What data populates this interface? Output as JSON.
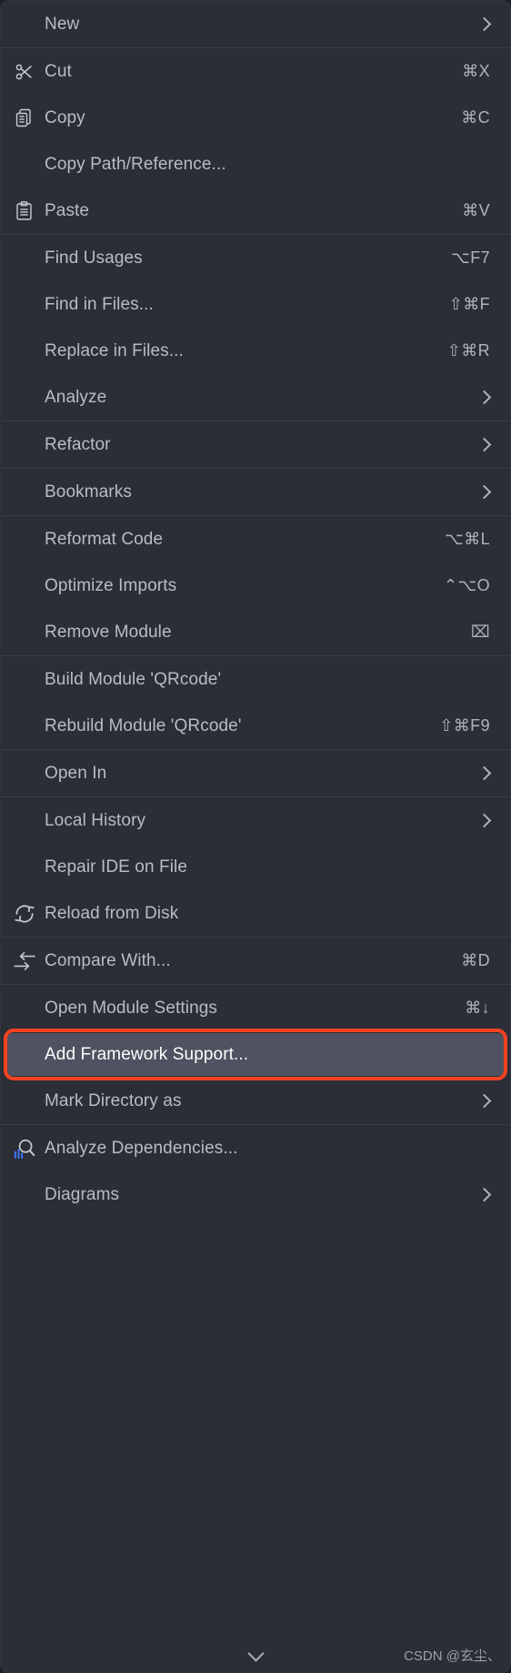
{
  "menu": {
    "type": "context-menu",
    "app": "JetBrains IDE project context menu",
    "colors": {
      "background": "#2b2d37",
      "separator": "#3b3e4a",
      "label": "#b9bcc7",
      "selected_background": "#4f5260",
      "selected_label": "#ffffff",
      "annotation_box": "#f4421f",
      "accent_blue": "#3c74f0"
    },
    "groups": [
      {
        "id": "group-new",
        "items": [
          {
            "label": "New",
            "shortcut": "",
            "submenu": true,
            "icon": ""
          }
        ]
      },
      {
        "id": "group-clipboard",
        "items": [
          {
            "label": "Cut",
            "shortcut": "⌘X",
            "submenu": false,
            "icon": "scissors-icon"
          },
          {
            "label": "Copy",
            "shortcut": "⌘C",
            "submenu": false,
            "icon": "copy-icon"
          },
          {
            "label": "Copy Path/Reference...",
            "shortcut": "",
            "submenu": false,
            "icon": ""
          },
          {
            "label": "Paste",
            "shortcut": "⌘V",
            "submenu": false,
            "icon": "paste-icon"
          }
        ]
      },
      {
        "id": "group-find",
        "items": [
          {
            "label": "Find Usages",
            "shortcut": "⌥F7",
            "submenu": false,
            "icon": ""
          },
          {
            "label": "Find in Files...",
            "shortcut": "⇧⌘F",
            "submenu": false,
            "icon": ""
          },
          {
            "label": "Replace in Files...",
            "shortcut": "⇧⌘R",
            "submenu": false,
            "icon": ""
          },
          {
            "label": "Analyze",
            "shortcut": "",
            "submenu": true,
            "icon": ""
          }
        ]
      },
      {
        "id": "group-refactor",
        "items": [
          {
            "label": "Refactor",
            "shortcut": "",
            "submenu": true,
            "icon": ""
          }
        ]
      },
      {
        "id": "group-bookmarks",
        "items": [
          {
            "label": "Bookmarks",
            "shortcut": "",
            "submenu": true,
            "icon": ""
          }
        ]
      },
      {
        "id": "group-code",
        "items": [
          {
            "label": "Reformat Code",
            "shortcut": "⌥⌘L",
            "submenu": false,
            "icon": ""
          },
          {
            "label": "Optimize Imports",
            "shortcut": "⌃⌥O",
            "submenu": false,
            "icon": ""
          },
          {
            "label": "Remove Module",
            "shortcut": "⌧",
            "submenu": false,
            "icon": ""
          }
        ]
      },
      {
        "id": "group-build",
        "items": [
          {
            "label": "Build Module 'QRcode'",
            "shortcut": "",
            "submenu": false,
            "icon": ""
          },
          {
            "label": "Rebuild Module 'QRcode'",
            "shortcut": "⇧⌘F9",
            "submenu": false,
            "icon": ""
          }
        ]
      },
      {
        "id": "group-openin",
        "items": [
          {
            "label": "Open In",
            "shortcut": "",
            "submenu": true,
            "icon": ""
          }
        ]
      },
      {
        "id": "group-history",
        "items": [
          {
            "label": "Local History",
            "shortcut": "",
            "submenu": true,
            "icon": ""
          },
          {
            "label": "Repair IDE on File",
            "shortcut": "",
            "submenu": false,
            "icon": ""
          },
          {
            "label": "Reload from Disk",
            "shortcut": "",
            "submenu": false,
            "icon": "reload-icon"
          }
        ]
      },
      {
        "id": "group-compare",
        "items": [
          {
            "label": "Compare With...",
            "shortcut": "⌘D",
            "submenu": false,
            "icon": "compare-icon"
          }
        ]
      },
      {
        "id": "group-module",
        "items": [
          {
            "label": "Open Module Settings",
            "shortcut": "⌘↓",
            "submenu": false,
            "icon": ""
          },
          {
            "label": "Add Framework Support...",
            "shortcut": "",
            "submenu": false,
            "icon": "",
            "selected": true,
            "annotated": true
          },
          {
            "label": "Mark Directory as",
            "shortcut": "",
            "submenu": true,
            "icon": ""
          }
        ]
      },
      {
        "id": "group-analyze",
        "items": [
          {
            "label": "Analyze Dependencies...",
            "shortcut": "",
            "submenu": false,
            "icon": "dependencies-icon"
          },
          {
            "label": "Diagrams",
            "shortcut": "",
            "submenu": true,
            "icon": ""
          }
        ]
      }
    ],
    "scroll_indicator": "chevron-down-icon",
    "watermark": "CSDN @玄尘、"
  }
}
